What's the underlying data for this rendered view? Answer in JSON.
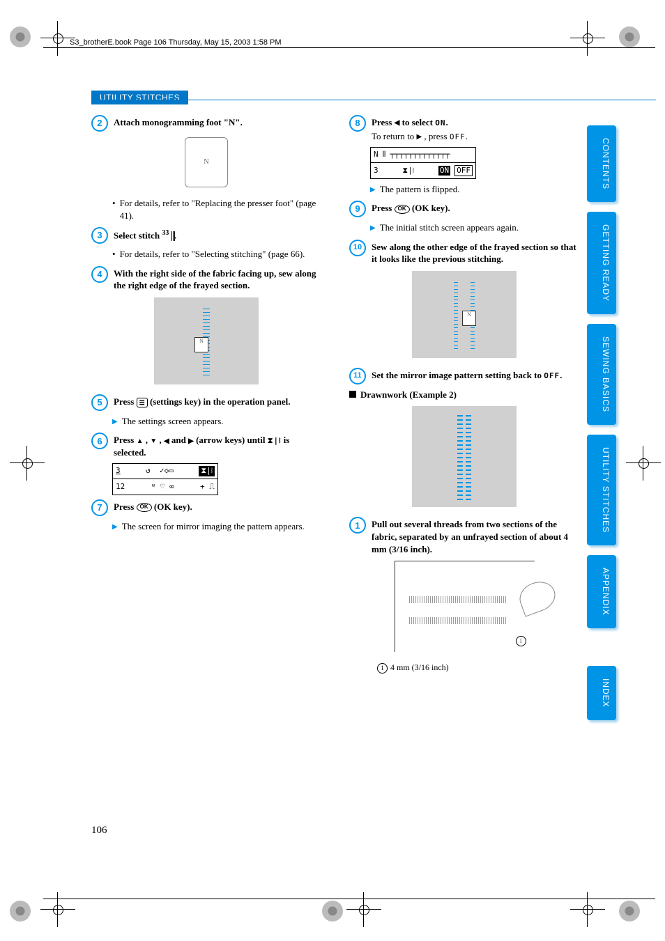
{
  "running_head": "S3_brotherE.book  Page 106  Thursday, May 15, 2003  1:58 PM",
  "section_header": "UTILITY STITCHES",
  "page_number": "106",
  "left": {
    "step2": "Attach monogramming foot \"N\".",
    "step2_bullet": "For details, refer to \"Replacing the presser foot\" (page 41).",
    "step3_a": "Select stitch ",
    "step3_sup": "33",
    "step3_b": " .",
    "step3_bullet": "For details, refer to \"Selecting stitching\" (page 66).",
    "step4": "With the right side of the fabric facing up, sew along the right edge of the frayed section.",
    "step5_a": "Press ",
    "step5_key": "☰",
    "step5_b": " (settings key) in the operation panel.",
    "step5_note": "The settings screen appears.",
    "step6_a": "Press ",
    "step6_mid": " ,  ,  and  (arrow keys) until ",
    "step6_b": " is selected.",
    "lcd6_tl": "3",
    "lcd6_bl": "12",
    "step7_a": "Press ",
    "step7_ok": "OK",
    "step7_b": " (OK key).",
    "step7_note": "The screen for mirror imaging the pattern appears."
  },
  "right": {
    "step8_a": "Press ",
    "step8_b": " to select ",
    "step8_on": "ON",
    "step8_c": ".",
    "step8_sub_a": "To return to ",
    "step8_sub_b": " , press ",
    "step8_off": "OFF",
    "step8_sub_c": ".",
    "lcd8_tl": "N",
    "lcd8_bl": "3",
    "lcd8_on": "ON",
    "lcd8_off": "OFF",
    "step8_note": "The pattern is flipped.",
    "step9_a": "Press ",
    "step9_ok": "OK",
    "step9_b": " (OK key).",
    "step9_note": "The initial stitch screen appears again.",
    "step10": "Sew along the other edge of the frayed section so that it looks like the previous stitching.",
    "step11_a": "Set the mirror image pattern setting back to ",
    "step11_off": "OFF",
    "step11_b": ".",
    "subheading": "Drawnwork (Example 2)",
    "ex2_step1": "Pull out several threads from two sections of the fabric, separated by an unfrayed section of about 4 mm (3/16 inch).",
    "callout1": "4 mm (3/16 inch)"
  },
  "tabs": [
    "CONTENTS",
    "GETTING READY",
    "SEWING BASICS",
    "UTILITY STITCHES",
    "APPENDIX",
    "INDEX"
  ]
}
